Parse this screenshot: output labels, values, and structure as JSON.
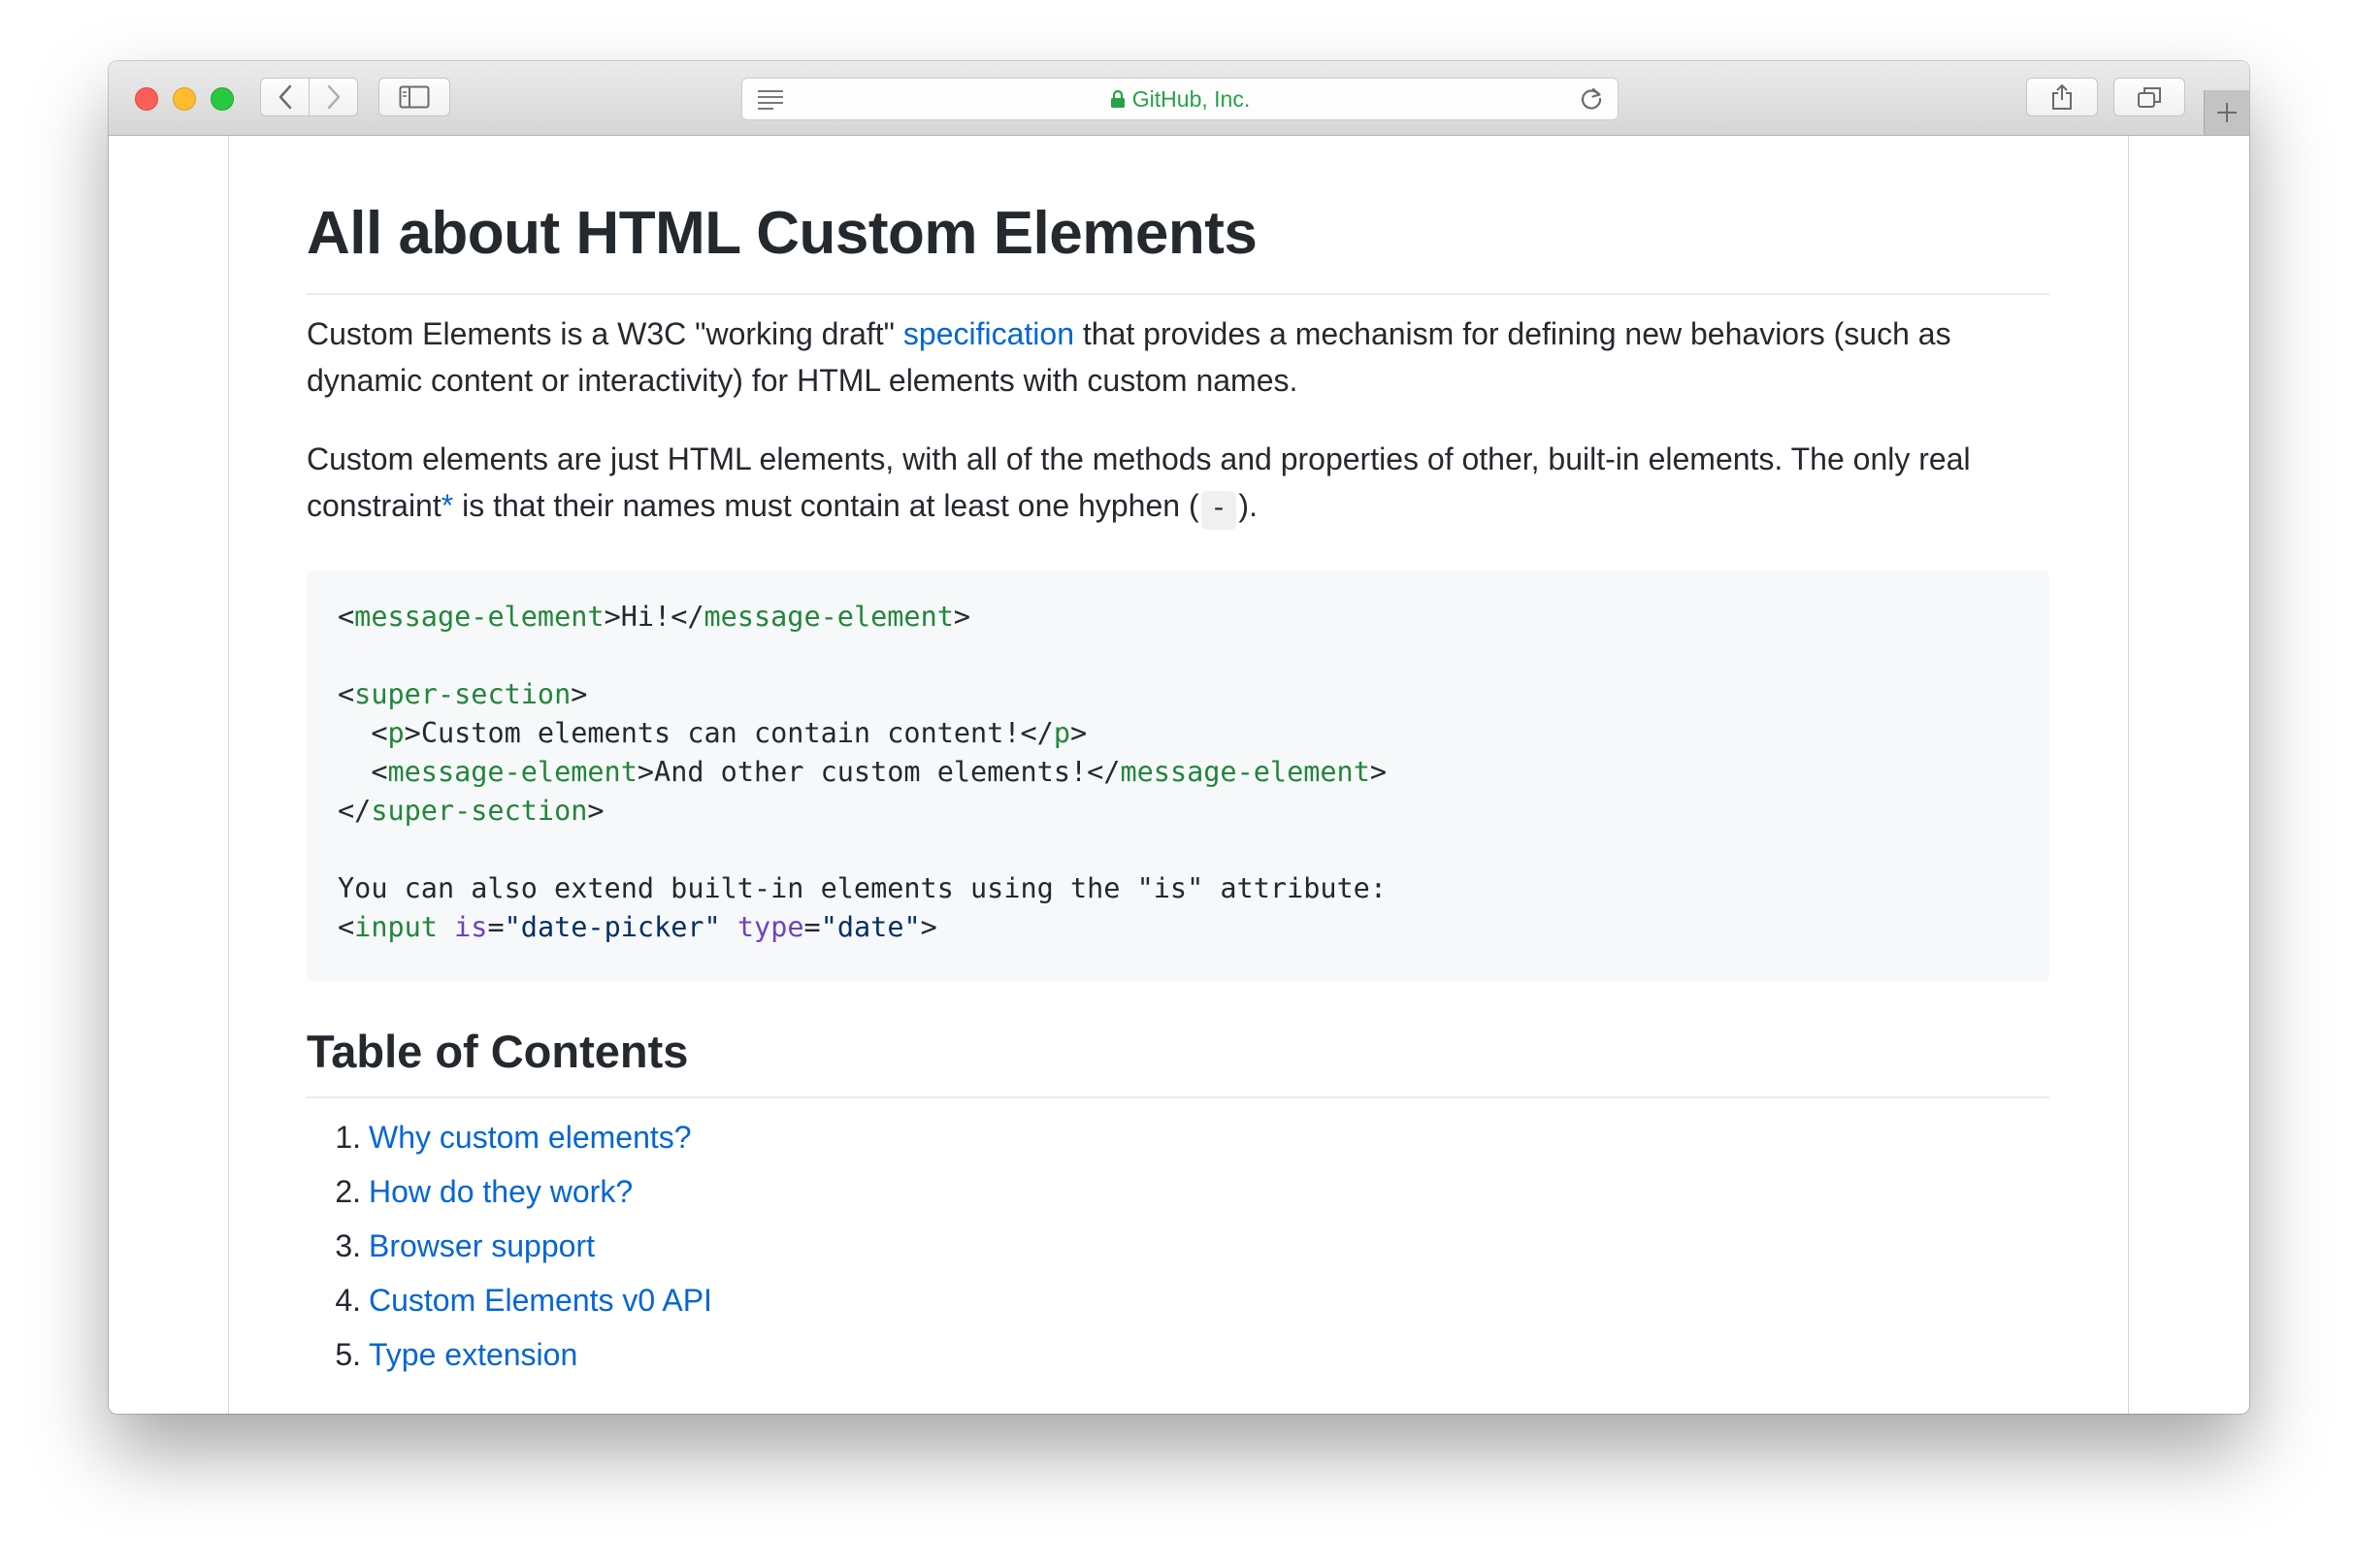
{
  "browser": {
    "address": {
      "site": "GitHub, Inc."
    }
  },
  "article": {
    "title": "All about HTML Custom Elements",
    "intro": {
      "before": "Custom Elements is a W3C \"working draft\" ",
      "link": "specification",
      "after": " that provides a mechanism for defining new behaviors (such as dynamic content or interactivity) for HTML elements with custom names."
    },
    "constraint": {
      "before": "Custom elements are just HTML elements, with all of the methods and properties of other, built-in elements. The only real constraint",
      "link": "*",
      "middle": " is that their names must contain at least one hyphen (",
      "code": "-",
      "after": ")."
    },
    "code_lines": [
      [
        [
          "p",
          "<"
        ],
        [
          "t",
          "message-element"
        ],
        [
          "p",
          ">Hi!</"
        ],
        [
          "t",
          "message-element"
        ],
        [
          "p",
          ">"
        ]
      ],
      [],
      [
        [
          "p",
          "<"
        ],
        [
          "t",
          "super-section"
        ],
        [
          "p",
          ">"
        ]
      ],
      [
        [
          "p",
          "  <"
        ],
        [
          "t",
          "p"
        ],
        [
          "p",
          ">Custom elements can contain content!</"
        ],
        [
          "t",
          "p"
        ],
        [
          "p",
          ">"
        ]
      ],
      [
        [
          "p",
          "  <"
        ],
        [
          "t",
          "message-element"
        ],
        [
          "p",
          ">And other custom elements!</"
        ],
        [
          "t",
          "message-element"
        ],
        [
          "p",
          ">"
        ]
      ],
      [
        [
          "p",
          "</"
        ],
        [
          "t",
          "super-section"
        ],
        [
          "p",
          ">"
        ]
      ],
      [],
      [
        [
          "p",
          "You can also extend built-in elements using the \"is\" attribute:"
        ]
      ],
      [
        [
          "p",
          "<"
        ],
        [
          "t",
          "input"
        ],
        [
          "p",
          " "
        ],
        [
          "a",
          "is"
        ],
        [
          "p",
          "="
        ],
        [
          "s",
          "\"date-picker\""
        ],
        [
          "p",
          " "
        ],
        [
          "a",
          "type"
        ],
        [
          "p",
          "="
        ],
        [
          "s",
          "\"date\""
        ],
        [
          "p",
          ">"
        ]
      ]
    ],
    "toc_title": "Table of Contents",
    "toc": [
      {
        "num": "1.",
        "label": "Why custom elements?"
      },
      {
        "num": "2.",
        "label": "How do they work?"
      },
      {
        "num": "3.",
        "label": "Browser support"
      },
      {
        "num": "4.",
        "label": "Custom Elements v0 API"
      },
      {
        "num": "5.",
        "label": "Type extension"
      }
    ]
  },
  "colors": {
    "link": "#0366d6",
    "code_tag": "#22863a",
    "code_attr": "#6f42c1",
    "code_string": "#032f62",
    "secure_site": "#26a148"
  },
  "icons": [
    "close-icon",
    "minimize-icon",
    "zoom-icon",
    "back-chevron-icon",
    "forward-chevron-icon",
    "sidebar-icon",
    "reader-icon",
    "lock-icon",
    "reload-icon",
    "share-icon",
    "tabs-icon",
    "plus-icon"
  ]
}
